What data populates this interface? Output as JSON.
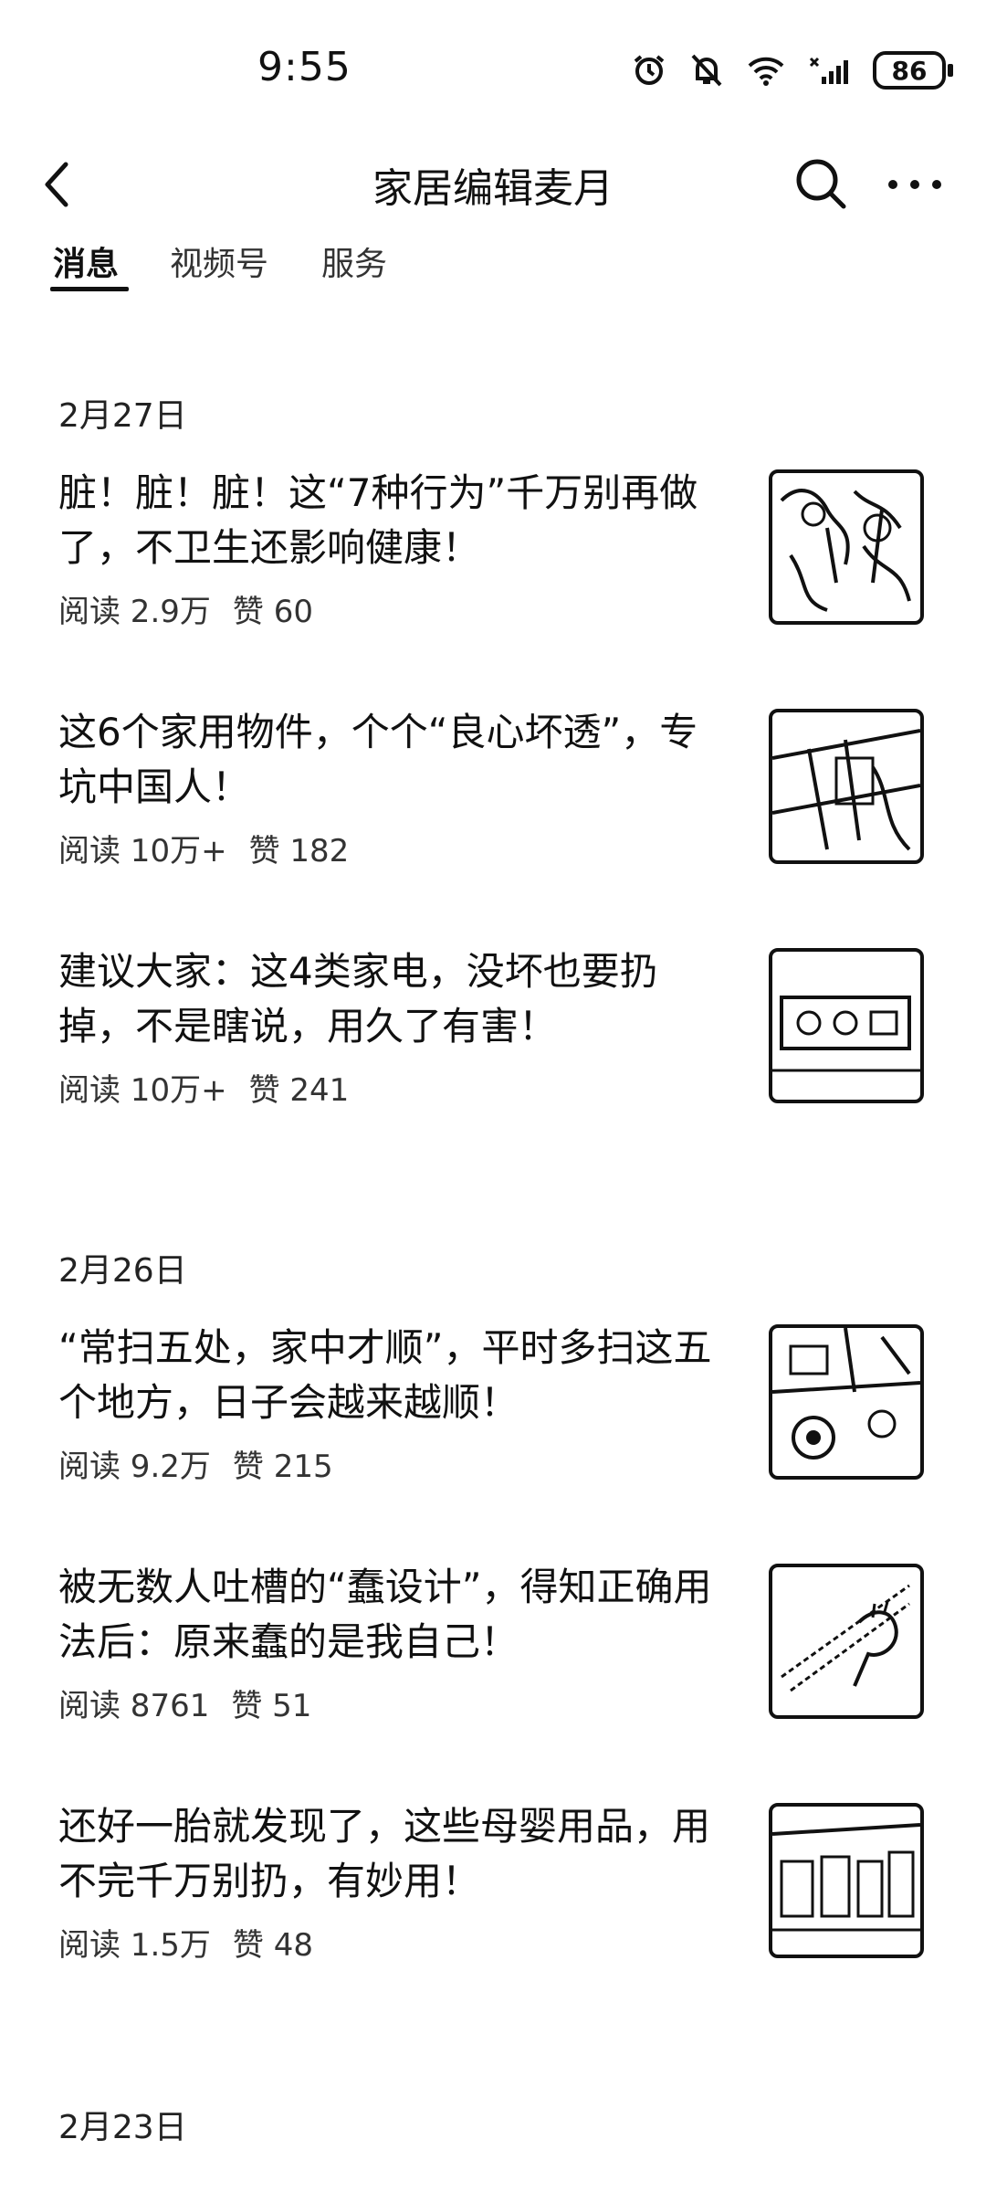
{
  "status_bar": {
    "time": "9:55",
    "battery": "86"
  },
  "header": {
    "title": "家居编辑麦月"
  },
  "tabs": [
    {
      "label": "消息"
    },
    {
      "label": "视频号"
    },
    {
      "label": "服务"
    }
  ],
  "groups": [
    {
      "date": "2月27日",
      "articles": [
        {
          "title": "脏！脏！脏！这“7种行为”千万别再做了，不卫生还影响健康！",
          "reads": "阅读 2.9万",
          "likes": "赞 60",
          "thumb_icon": "crowd-photo"
        },
        {
          "title": "这6个家用物件，个个“良心坏透”，专坑中国人！",
          "reads": "阅读 10万+",
          "likes": "赞 182",
          "thumb_icon": "household-items-photo"
        },
        {
          "title": "建议大家：这4类家电，没坏也要扔掉，不是瞎说，用久了有害！",
          "reads": "阅读 10万+",
          "likes": "赞 241",
          "thumb_icon": "power-socket-photo"
        }
      ]
    },
    {
      "date": "2月26日",
      "articles": [
        {
          "title": "“常扫五处，家中才顺”，平时多扫这五个地方，日子会越来越顺！",
          "reads": "阅读 9.2万",
          "likes": "赞 215",
          "thumb_icon": "kitchen-photo"
        },
        {
          "title": "被无数人吐槽的“蠢设计”，得知正确用法后：原来蠢的是我自己！",
          "reads": "阅读 8761",
          "likes": "赞 51",
          "thumb_icon": "hand-gesture-photo"
        },
        {
          "title": "还好一胎就发现了，这些母婴用品，用不完千万别扔，有妙用！",
          "reads": "阅读 1.5万",
          "likes": "赞 48",
          "thumb_icon": "storage-room-photo"
        }
      ]
    },
    {
      "date": "2月23日",
      "articles": []
    }
  ]
}
